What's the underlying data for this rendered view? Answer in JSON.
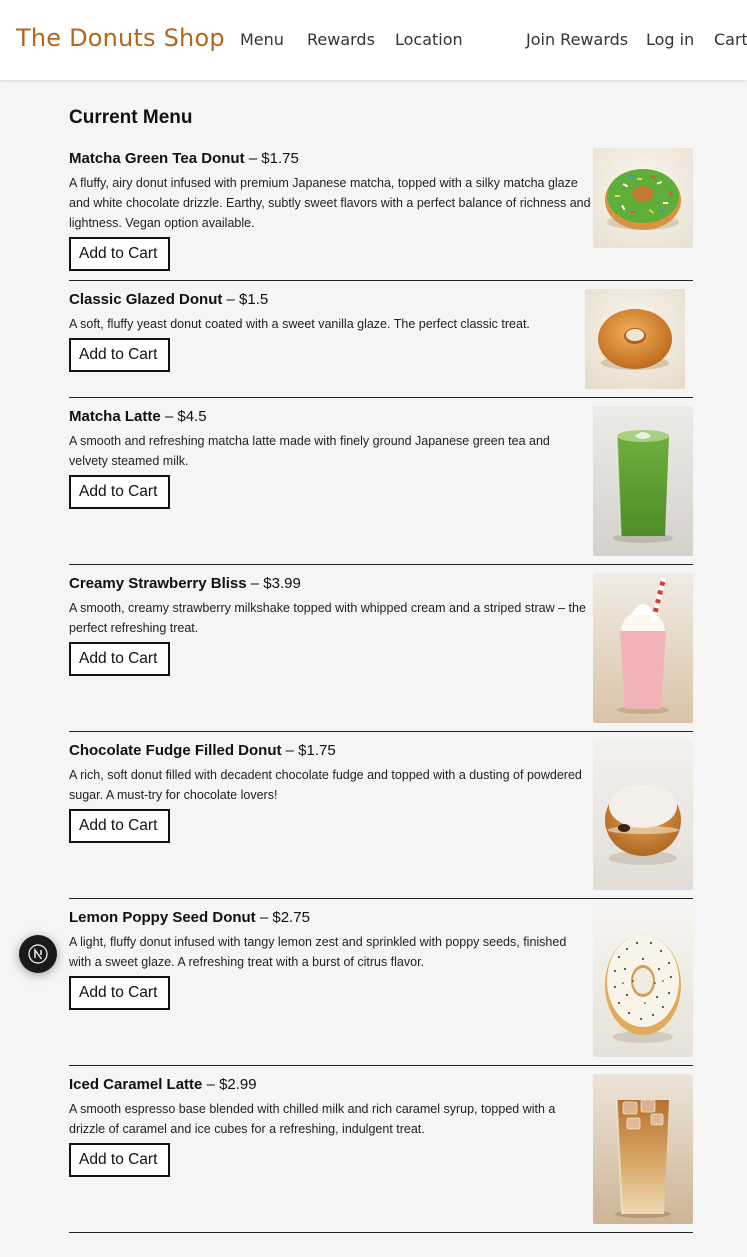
{
  "header": {
    "brand": "The Donuts Shop",
    "nav": [
      "Menu",
      "Rewards",
      "Location"
    ],
    "account": [
      "Join Rewards",
      "Log in",
      "Cart"
    ]
  },
  "main": {
    "title": "Current Menu",
    "add_label": "Add to Cart",
    "items": [
      {
        "name": "Matcha Green Tea Donut",
        "price": "– $1.75",
        "description": "A fluffy, airy donut infused with premium Japanese matcha, topped with a silky matcha glaze and white chocolate drizzle. Earthy, subtly sweet flavors with a perfect balance of richness and lightness. Vegan option available.",
        "image": "matcha-donut-image"
      },
      {
        "name": "Classic Glazed Donut",
        "price": "– $1.5",
        "description": "A soft, fluffy yeast donut coated with a sweet vanilla glaze. The perfect classic treat.",
        "image": "glazed-donut-image"
      },
      {
        "name": "Matcha Latte",
        "price": "– $4.5",
        "description": "A smooth and refreshing matcha latte made with finely ground Japanese green tea and velvety steamed milk.",
        "image": "matcha-latte-image"
      },
      {
        "name": "Creamy Strawberry Bliss",
        "price": "– $3.99",
        "description": "A smooth, creamy strawberry milkshake topped with whipped cream and a striped straw – the perfect refreshing treat.",
        "image": "strawberry-shake-image"
      },
      {
        "name": "Chocolate Fudge Filled Donut",
        "price": "– $1.75",
        "description": "A rich, soft donut filled with decadent chocolate fudge and topped with a dusting of powdered sugar. A must-try for chocolate lovers!",
        "image": "fudge-donut-image"
      },
      {
        "name": "Lemon Poppy Seed Donut",
        "price": "– $2.75",
        "description": "A light, fluffy donut infused with tangy lemon zest and sprinkled with poppy seeds, finished with a sweet glaze. A refreshing treat with a burst of citrus flavor.",
        "image": "lemon-poppy-donut-image"
      },
      {
        "name": "Iced Caramel Latte",
        "price": "– $2.99",
        "description": "A smooth espresso base blended with chilled milk and rich caramel syrup, topped with a drizzle of caramel and ice cubes for a refreshing, indulgent treat.",
        "image": "iced-caramel-latte-image"
      }
    ]
  },
  "colors": {
    "brand": "#b5651d",
    "background": "#f5f5f5"
  },
  "dev_badge": {
    "icon": "n-logo-icon"
  }
}
